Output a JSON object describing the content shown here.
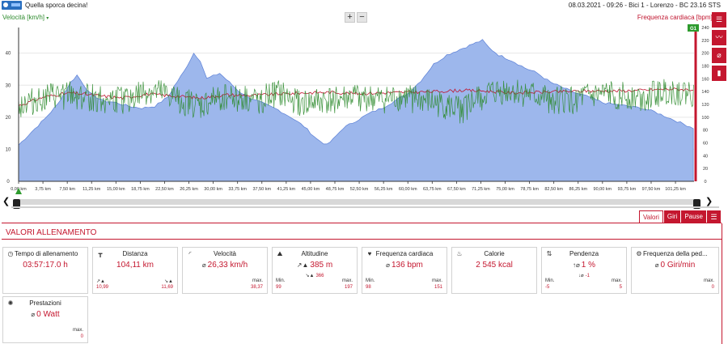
{
  "header": {
    "title": "Quella sporca decina!",
    "meta": "08.03.2021  -  09:26  -  Bici 1  -  Lorenzo  -  BC 23.16 STS"
  },
  "chart_head": {
    "left_label": "Velocità [km/h]",
    "right_label": "Frequenza cardiaca [bpm]",
    "zoom_in": "+",
    "zoom_out": "−",
    "marker": "G1"
  },
  "colors": {
    "accent": "#c4172f",
    "speed": "#2e8b2e",
    "heart": "#c0152f",
    "altitude_fill": "#9db7ec",
    "altitude_line": "#5a7fd6"
  },
  "side_tools": [
    "list-icon",
    "line-chart-icon",
    "no-entry-icon",
    "bar-chart-icon"
  ],
  "chart_data": {
    "type": "line",
    "left_axis": {
      "ticks": [
        "0",
        "10",
        "20",
        "30",
        "40"
      ],
      "ylim": [
        0,
        48
      ]
    },
    "right_axis": {
      "ticks": [
        "0",
        "20",
        "40",
        "60",
        "80",
        "100",
        "120",
        "140",
        "160",
        "180",
        "200",
        "220",
        "240"
      ],
      "ylim": [
        0,
        240
      ]
    },
    "x_ticks": [
      "0,00 km",
      "3,75 km",
      "7,50 km",
      "11,25 km",
      "15,00 km",
      "18,75 km",
      "22,50 km",
      "26,25 km",
      "30,00 km",
      "33,75 km",
      "37,50 km",
      "41,25 km",
      "45,00 km",
      "48,75 km",
      "52,50 km",
      "56,25 km",
      "60,00 km",
      "63,75 km",
      "67,50 km",
      "71,25 km",
      "75,00 km",
      "78,75 km",
      "82,50 km",
      "86,25 km",
      "90,00 km",
      "93,75 km",
      "97,50 km",
      "101,25 km"
    ],
    "xlim": [
      0,
      104.11
    ],
    "series": [
      {
        "name": "Altitudine",
        "unit": "m",
        "axis": "hidden",
        "range": [
          0,
          420
        ],
        "x": [
          0,
          2,
          4,
          6,
          8,
          9,
          11,
          13,
          15,
          17,
          19,
          21,
          23,
          24,
          25.5,
          27,
          28,
          29,
          31,
          32.5,
          34,
          36,
          38,
          40,
          42,
          44,
          46,
          47.5,
          48.5,
          50,
          52,
          54,
          56,
          58,
          60,
          62,
          64,
          66,
          68,
          70,
          71.5,
          72.5,
          74,
          76,
          78,
          80,
          82,
          84,
          86,
          88,
          90,
          92,
          94,
          96,
          98,
          100,
          102,
          104.11
        ],
        "y": [
          99,
          135,
          170,
          210,
          270,
          290,
          240,
          220,
          215,
          205,
          200,
          205,
          230,
          260,
          300,
          350,
          330,
          280,
          295,
          270,
          245,
          225,
          210,
          195,
          175,
          150,
          115,
          99,
          115,
          145,
          165,
          185,
          200,
          220,
          240,
          275,
          320,
          345,
          360,
          375,
          385,
          365,
          345,
          330,
          310,
          295,
          270,
          255,
          240,
          230,
          215,
          210,
          205,
          200,
          190,
          175,
          160,
          145
        ]
      },
      {
        "name": "Velocità",
        "unit": "km/h",
        "axis": "left",
        "x": [
          0,
          4,
          8,
          12,
          16,
          20,
          24,
          28,
          32,
          36,
          40,
          44,
          48,
          52,
          56,
          60,
          64,
          68,
          72,
          76,
          80,
          84,
          88,
          92,
          96,
          100,
          104.11
        ],
        "y": [
          24,
          26,
          27,
          26,
          25,
          28,
          26,
          23,
          27,
          25,
          27,
          24,
          25,
          26,
          25,
          26,
          24,
          22,
          27,
          28,
          26,
          25,
          26,
          27,
          26,
          28,
          27
        ]
      },
      {
        "name": "Frequenza cardiaca",
        "unit": "bpm",
        "axis": "right",
        "x": [
          0,
          4,
          8,
          12,
          16,
          20,
          24,
          28,
          32,
          36,
          40,
          44,
          48,
          52,
          56,
          60,
          64,
          68,
          72,
          76,
          80,
          84,
          88,
          92,
          96,
          100,
          104.11
        ],
        "y": [
          118,
          132,
          138,
          134,
          130,
          136,
          133,
          130,
          135,
          134,
          136,
          138,
          139,
          137,
          138,
          139,
          140,
          142,
          141,
          138,
          139,
          140,
          141,
          141,
          142,
          144,
          143
        ]
      }
    ]
  },
  "scroller": {
    "prev": "❮",
    "next": "❯"
  },
  "tabs": {
    "valori": "Valori",
    "giri": "Giri",
    "pause": "Pause"
  },
  "section_title": "VALORI ALLENAMENTO",
  "cards": {
    "tempo": {
      "title": "Tempo di allenamento",
      "value": "03:57:17.0 h"
    },
    "distanza": {
      "title": "Distanza",
      "value": "104,11 km",
      "up": "10,99",
      "down": "11,69"
    },
    "velocita": {
      "title": "Velocità",
      "sym": "⌀",
      "value": "26,33 km/h",
      "max_label": "max.",
      "max": "38,37"
    },
    "altitudine": {
      "title": "Altitudine",
      "up_value": "385 m",
      "down_value": "366",
      "min_label": "Min.",
      "min": "99",
      "max_label": "max.",
      "max": "197"
    },
    "frequenza": {
      "title": "Frequenza cardiaca",
      "sym": "⌀",
      "value": "136 bpm",
      "min_label": "Min.",
      "min": "98",
      "max_label": "max.",
      "max": "151"
    },
    "calorie": {
      "title": "Calorie",
      "value": "2 545 kcal"
    },
    "pendenza": {
      "title": "Pendenza",
      "up_value": "1 %",
      "down_value": "-1",
      "min_label": "Min.",
      "min": "-5",
      "max_label": "max.",
      "max": "5"
    },
    "pedalata": {
      "title": "Frequenza della ped...",
      "sym": "⌀",
      "value": "0 Giri/min",
      "max_label": "max.",
      "max": "0"
    },
    "prestazioni": {
      "title": "Prestazioni",
      "sym": "⌀",
      "value": "0 Watt",
      "max_label": "max.",
      "max": "0"
    }
  }
}
